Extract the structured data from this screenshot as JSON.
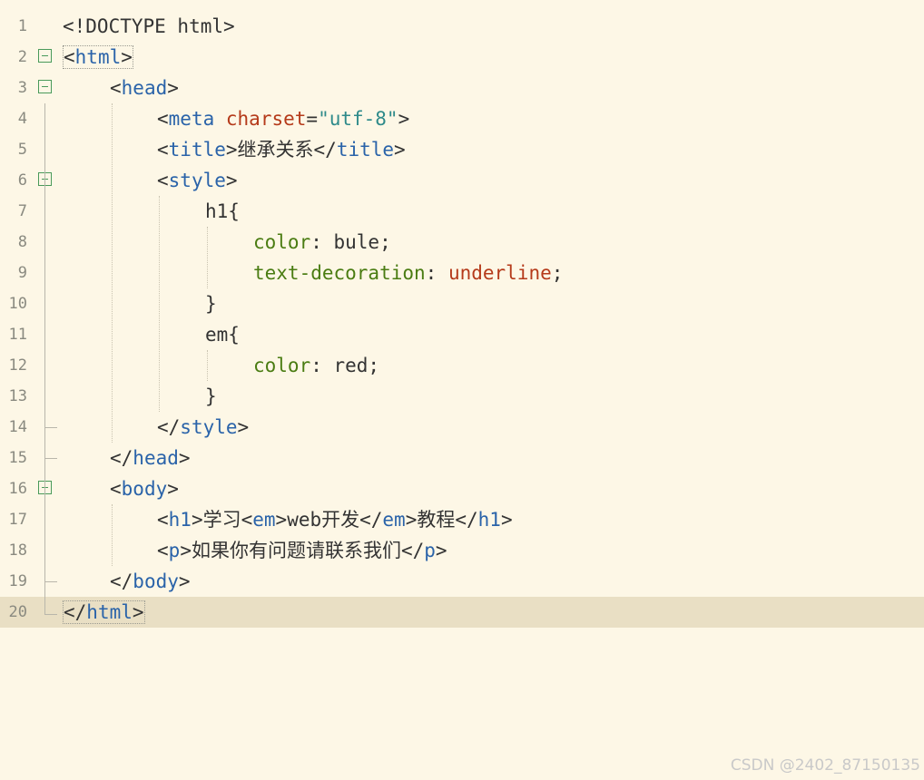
{
  "editor": {
    "lines": [
      {
        "num": "1",
        "segments": [
          {
            "text": "<!DOCTYPE html>",
            "cls": ""
          }
        ]
      },
      {
        "num": "2",
        "segments": [
          {
            "text": "<html>",
            "cls": "br"
          }
        ]
      },
      {
        "num": "3",
        "segments": [
          {
            "text": "<",
            "cls": ""
          },
          {
            "text": "head",
            "cls": "t"
          },
          {
            "text": ">",
            "cls": ""
          }
        ]
      },
      {
        "num": "4",
        "segments": [
          {
            "text": "<",
            "cls": ""
          },
          {
            "text": "meta",
            "cls": "t"
          },
          {
            "text": " ",
            "cls": ""
          },
          {
            "text": "charset",
            "cls": "a"
          },
          {
            "text": "=",
            "cls": ""
          },
          {
            "text": "\"utf-8\"",
            "cls": "s"
          },
          {
            "text": ">",
            "cls": ""
          }
        ]
      },
      {
        "num": "5",
        "segments": [
          {
            "text": "<",
            "cls": ""
          },
          {
            "text": "title",
            "cls": "t"
          },
          {
            "text": ">继承关系</",
            "cls": ""
          },
          {
            "text": "title",
            "cls": "t"
          },
          {
            "text": ">",
            "cls": ""
          }
        ]
      },
      {
        "num": "6",
        "segments": [
          {
            "text": "<",
            "cls": ""
          },
          {
            "text": "style",
            "cls": "t"
          },
          {
            "text": ">",
            "cls": ""
          }
        ]
      },
      {
        "num": "7",
        "segments": [
          {
            "text": "h1{",
            "cls": ""
          }
        ]
      },
      {
        "num": "8",
        "segments": [
          {
            "text": "color",
            "cls": "p"
          },
          {
            "text": ": bule;",
            "cls": ""
          }
        ]
      },
      {
        "num": "9",
        "segments": [
          {
            "text": "text-decoration",
            "cls": "p"
          },
          {
            "text": ": ",
            "cls": ""
          },
          {
            "text": "underline",
            "cls": "v"
          },
          {
            "text": ";",
            "cls": ""
          }
        ]
      },
      {
        "num": "10",
        "segments": [
          {
            "text": "}",
            "cls": ""
          }
        ]
      },
      {
        "num": "11",
        "segments": [
          {
            "text": "em{",
            "cls": ""
          }
        ]
      },
      {
        "num": "12",
        "segments": [
          {
            "text": "color",
            "cls": "p"
          },
          {
            "text": ": red;",
            "cls": ""
          }
        ]
      },
      {
        "num": "13",
        "segments": [
          {
            "text": "}",
            "cls": ""
          }
        ]
      },
      {
        "num": "14",
        "segments": [
          {
            "text": "</",
            "cls": ""
          },
          {
            "text": "style",
            "cls": "t"
          },
          {
            "text": ">",
            "cls": ""
          }
        ]
      },
      {
        "num": "15",
        "segments": [
          {
            "text": "</",
            "cls": ""
          },
          {
            "text": "head",
            "cls": "t"
          },
          {
            "text": ">",
            "cls": ""
          }
        ]
      },
      {
        "num": "16",
        "segments": [
          {
            "text": "<",
            "cls": ""
          },
          {
            "text": "body",
            "cls": "t"
          },
          {
            "text": ">",
            "cls": ""
          }
        ]
      },
      {
        "num": "17",
        "segments": [
          {
            "text": "<",
            "cls": ""
          },
          {
            "text": "h1",
            "cls": "t"
          },
          {
            "text": ">学习<",
            "cls": ""
          },
          {
            "text": "em",
            "cls": "t"
          },
          {
            "text": ">web开发</",
            "cls": ""
          },
          {
            "text": "em",
            "cls": "t"
          },
          {
            "text": ">教程</",
            "cls": ""
          },
          {
            "text": "h1",
            "cls": "t"
          },
          {
            "text": ">",
            "cls": ""
          }
        ]
      },
      {
        "num": "18",
        "segments": [
          {
            "text": "<",
            "cls": ""
          },
          {
            "text": "p",
            "cls": "t"
          },
          {
            "text": ">如果你有问题请联系我们</",
            "cls": ""
          },
          {
            "text": "p",
            "cls": "t"
          },
          {
            "text": ">",
            "cls": ""
          }
        ]
      },
      {
        "num": "19",
        "segments": [
          {
            "text": "</",
            "cls": ""
          },
          {
            "text": "body",
            "cls": "t"
          },
          {
            "text": ">",
            "cls": ""
          }
        ]
      },
      {
        "num": "20",
        "segments": [
          {
            "text": "</html>",
            "cls": "br"
          }
        ]
      }
    ]
  },
  "watermark": {
    "text": "CSDN @2402_87150135"
  },
  "colors": {
    "background": "#fdf7e6",
    "current_line": "#e9dfc4",
    "tag": "#2a63a9",
    "attribute": "#b53a1a",
    "string": "#2e8a8a",
    "css_property": "#4a7c12",
    "fold_marker": "#4a9a5a"
  }
}
